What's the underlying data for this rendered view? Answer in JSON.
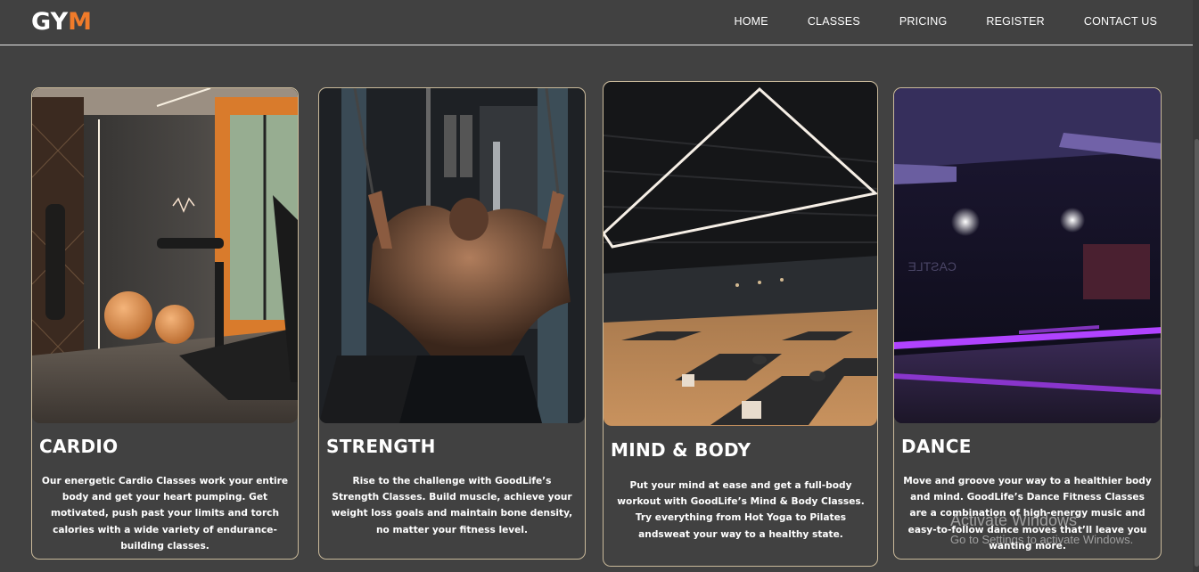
{
  "logo": {
    "part1": "GY",
    "part2": "M"
  },
  "nav": {
    "items": [
      {
        "label": "HOME"
      },
      {
        "label": "CLASSES"
      },
      {
        "label": "PRICING"
      },
      {
        "label": "REGISTER"
      },
      {
        "label": "CONTACT US"
      }
    ]
  },
  "cards": [
    {
      "title": "CARDIO",
      "description": "Our energetic Cardio Classes work your entire body and get your heart pumping. Get motivated, push past your limits and torch calories with a wide variety of endurance-building classes."
    },
    {
      "title": "STRENGTH",
      "description": "Rise to the challenge with GoodLife’s Strength Classes. Build muscle, achieve your weight loss goals and maintain bone density, no matter your fitness level."
    },
    {
      "title": "MIND & BODY",
      "description": "Put your mind at ease and get a full-body workout with GoodLife’s Mind & Body Classes. Try everything from Hot Yoga to Pilates andsweat your way to a healthy state."
    },
    {
      "title": "DANCE",
      "description": "Move and groove your way to a healthier body and mind. GoodLife’s Dance Fitness Classes are a combination of high-energy music and easy-to-follow dance moves that’ll leave you wanting more."
    }
  ],
  "watermark": {
    "line1": "Activate Windows",
    "line2": "Go to Settings to activate Windows."
  },
  "colors": {
    "background": "#414141",
    "accent": "#f07b2a",
    "card_border": "#c9b99a",
    "text": "#ffffff"
  }
}
